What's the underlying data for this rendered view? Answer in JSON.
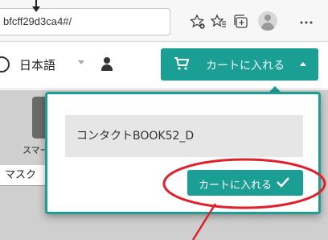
{
  "browser": {
    "url_fragment": "bfcff29d3ca4#/"
  },
  "header": {
    "language_label": "日本語",
    "cart_button_label": "カートに入れる"
  },
  "background": {
    "thumbnail_caption": "スマー",
    "mask_text": "マスク"
  },
  "popup": {
    "product_name": "コンタクトBOOK52_D",
    "add_button_label": "カートに入れる"
  },
  "colors": {
    "accent": "#1b9e93",
    "annotation": "#e0202a"
  }
}
